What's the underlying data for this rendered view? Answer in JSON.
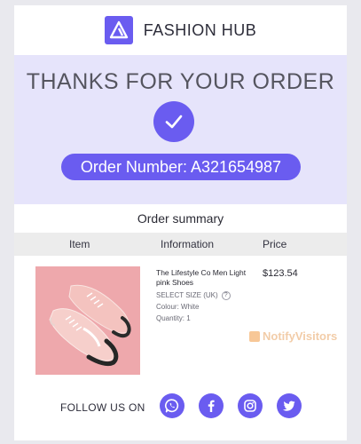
{
  "brand": {
    "name": "FASHION HUB",
    "logo_icon": "triangle-logo-icon"
  },
  "hero": {
    "title": "THANKS FOR YOUR ORDER",
    "check_icon": "checkmark-icon",
    "order_number": "Order Number: A321654987"
  },
  "summary": {
    "title": "Order summary",
    "columns": [
      "Item",
      "Information",
      "Price"
    ]
  },
  "product": {
    "name": "The Lifestyle Co Men Light pink Shoes",
    "size_label": "SELECT SIZE (UK)",
    "size_help": "?",
    "colour": "Colour: White",
    "quantity": "Quantity: 1",
    "price": "$123.54",
    "image": "pink-sneakers-image"
  },
  "watermark": {
    "text": "NotifyVisitors"
  },
  "footer": {
    "follow_label": "FOLLOW US ON",
    "social_icons": [
      "whatsapp-icon",
      "facebook-icon",
      "instagram-icon",
      "twitter-icon"
    ]
  },
  "colors": {
    "accent": "#6a5cf0",
    "hero_bg": "#e6e4fb",
    "table_head_bg": "#ececec",
    "product_bg": "#eea8ac"
  }
}
